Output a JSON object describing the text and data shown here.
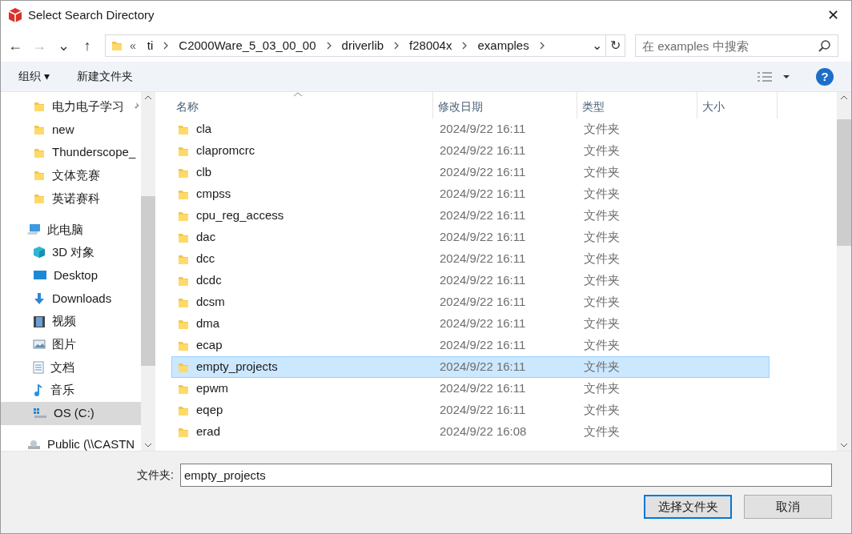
{
  "window": {
    "title": "Select Search Directory",
    "close": "✕"
  },
  "nav": {
    "back": "←",
    "forward": "→",
    "recent": "⌄",
    "up": "↑",
    "overflow": "«",
    "refresh": "↻",
    "dropdown": "⌄"
  },
  "breadcrumb": [
    {
      "label": "ti"
    },
    {
      "label": "C2000Ware_5_03_00_00"
    },
    {
      "label": "driverlib"
    },
    {
      "label": "f28004x"
    },
    {
      "label": "examples"
    }
  ],
  "search": {
    "placeholder": "在 examples 中搜索"
  },
  "toolbar": {
    "organize": "组织 ▾",
    "new_folder": "新建文件夹",
    "help": "?"
  },
  "sidebar": {
    "items": [
      {
        "label": "电力电子学习",
        "kind": "folder",
        "pinned": true,
        "selected": false
      },
      {
        "label": "new",
        "kind": "folder",
        "pinned": false,
        "selected": false
      },
      {
        "label": "Thunderscope_",
        "kind": "folder",
        "pinned": false,
        "selected": false
      },
      {
        "label": "文体竞赛",
        "kind": "folder",
        "pinned": false,
        "selected": false
      },
      {
        "label": "英诺赛科",
        "kind": "folder",
        "pinned": false,
        "selected": false
      },
      {
        "label": "此电脑",
        "kind": "pc",
        "pinned": false,
        "selected": false
      },
      {
        "label": "3D 对象",
        "kind": "cube",
        "pinned": false,
        "selected": false
      },
      {
        "label": "Desktop",
        "kind": "desktop",
        "pinned": false,
        "selected": false
      },
      {
        "label": "Downloads",
        "kind": "download",
        "pinned": false,
        "selected": false
      },
      {
        "label": "视频",
        "kind": "video",
        "pinned": false,
        "selected": false
      },
      {
        "label": "图片",
        "kind": "picture",
        "pinned": false,
        "selected": false
      },
      {
        "label": "文档",
        "kind": "document",
        "pinned": false,
        "selected": false
      },
      {
        "label": "音乐",
        "kind": "music",
        "pinned": false,
        "selected": false
      },
      {
        "label": "OS (C:)",
        "kind": "drive",
        "pinned": false,
        "selected": true
      },
      {
        "label": "Public (\\\\CASTN",
        "kind": "network",
        "pinned": false,
        "selected": false
      }
    ]
  },
  "table": {
    "columns": [
      "名称",
      "修改日期",
      "类型",
      "大小"
    ],
    "rows": [
      {
        "name": "cla",
        "modified": "2024/9/22 16:11",
        "type": "文件夹",
        "selected": false
      },
      {
        "name": "clapromcrc",
        "modified": "2024/9/22 16:11",
        "type": "文件夹",
        "selected": false
      },
      {
        "name": "clb",
        "modified": "2024/9/22 16:11",
        "type": "文件夹",
        "selected": false
      },
      {
        "name": "cmpss",
        "modified": "2024/9/22 16:11",
        "type": "文件夹",
        "selected": false
      },
      {
        "name": "cpu_reg_access",
        "modified": "2024/9/22 16:11",
        "type": "文件夹",
        "selected": false
      },
      {
        "name": "dac",
        "modified": "2024/9/22 16:11",
        "type": "文件夹",
        "selected": false
      },
      {
        "name": "dcc",
        "modified": "2024/9/22 16:11",
        "type": "文件夹",
        "selected": false
      },
      {
        "name": "dcdc",
        "modified": "2024/9/22 16:11",
        "type": "文件夹",
        "selected": false
      },
      {
        "name": "dcsm",
        "modified": "2024/9/22 16:11",
        "type": "文件夹",
        "selected": false
      },
      {
        "name": "dma",
        "modified": "2024/9/22 16:11",
        "type": "文件夹",
        "selected": false
      },
      {
        "name": "ecap",
        "modified": "2024/9/22 16:11",
        "type": "文件夹",
        "selected": false
      },
      {
        "name": "empty_projects",
        "modified": "2024/9/22 16:11",
        "type": "文件夹",
        "selected": true
      },
      {
        "name": "epwm",
        "modified": "2024/9/22 16:11",
        "type": "文件夹",
        "selected": false
      },
      {
        "name": "eqep",
        "modified": "2024/9/22 16:11",
        "type": "文件夹",
        "selected": false
      },
      {
        "name": "erad",
        "modified": "2024/9/22 16:08",
        "type": "文件夹",
        "selected": false
      }
    ]
  },
  "folder_field": {
    "label": "文件夹:",
    "value": "empty_projects"
  },
  "buttons": [
    {
      "label": "选择文件夹",
      "kind": "primary"
    },
    {
      "label": "取消",
      "kind": "secondary"
    }
  ]
}
